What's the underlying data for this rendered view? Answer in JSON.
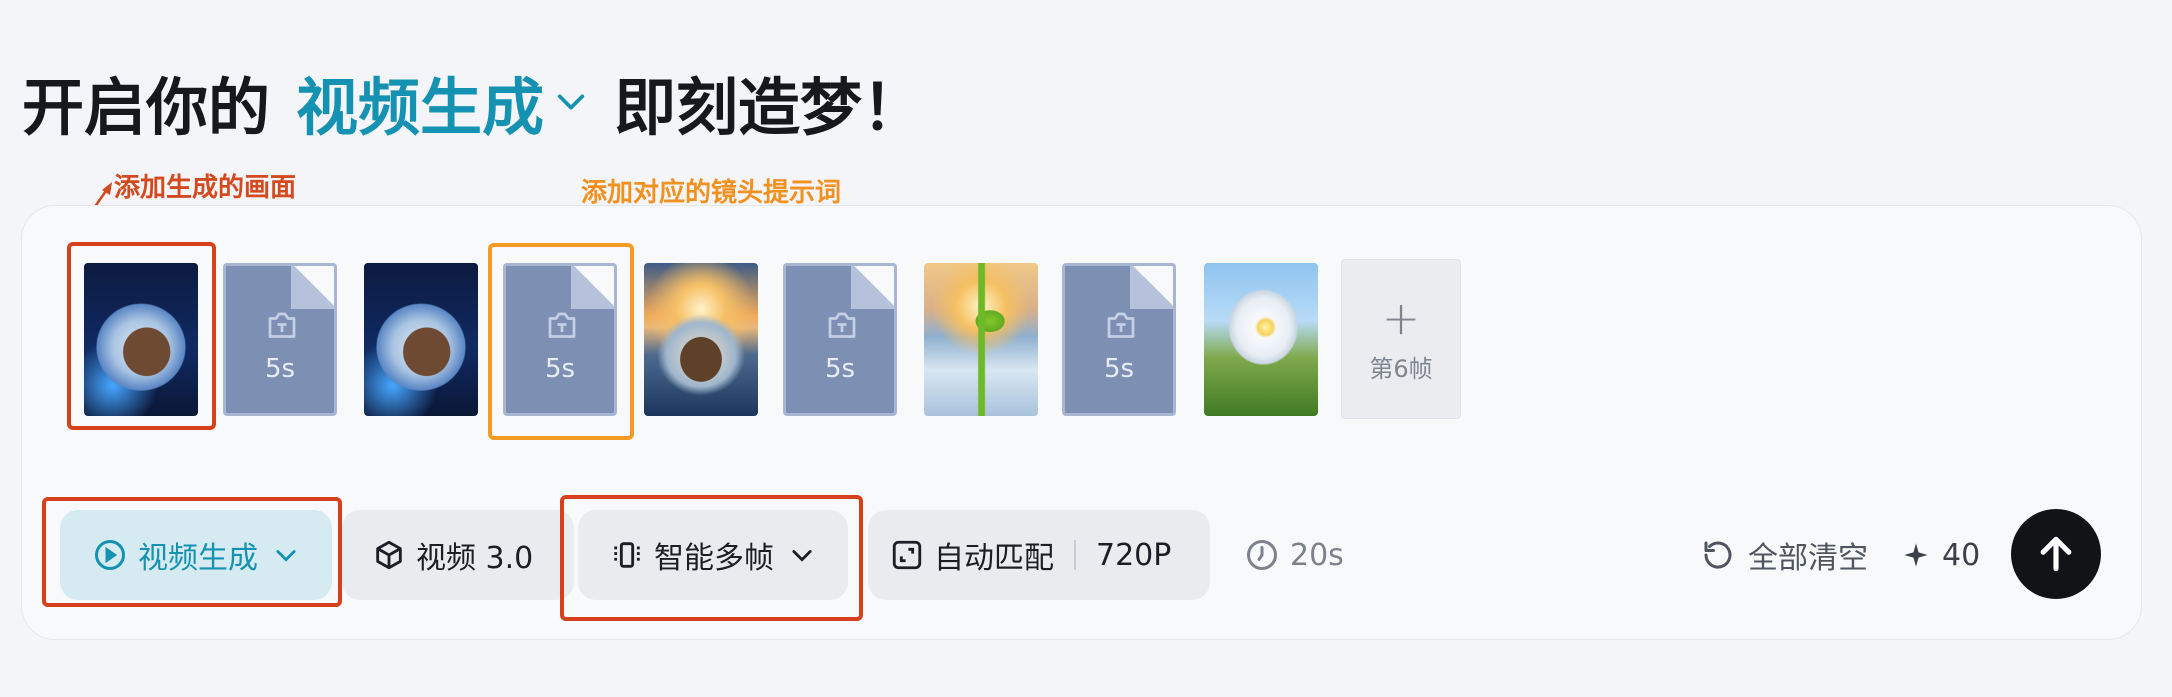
{
  "headline": {
    "prefix": "开启你的",
    "mode": "视频生成",
    "suffix": "即刻造梦！"
  },
  "annotations": {
    "add_frame_note": "添加生成的画面",
    "add_prompt_note": "添加对应的镜头提示词"
  },
  "timeline": {
    "frames": [
      {
        "kind": "image",
        "icon": "ice-crystal-image"
      },
      {
        "kind": "prompt",
        "duration": "5s"
      },
      {
        "kind": "image",
        "icon": "ice-crystal-image"
      },
      {
        "kind": "prompt",
        "duration": "5s"
      },
      {
        "kind": "image",
        "icon": "sunset-ice-image"
      },
      {
        "kind": "prompt",
        "duration": "5s"
      },
      {
        "kind": "image",
        "icon": "sprout-image"
      },
      {
        "kind": "prompt",
        "duration": "5s"
      },
      {
        "kind": "image",
        "icon": "flower-image"
      }
    ],
    "add_label": "第6帧"
  },
  "toolbar": {
    "mode_label": "视频生成",
    "model_label": "视频 3.0",
    "multi_frame_label": "智能多帧",
    "ratio_label": "自动匹配",
    "resolution_label": "720P",
    "duration_label": "20s",
    "clear_label": "全部清空",
    "credits": "40"
  },
  "colors": {
    "accent": "#1592b1",
    "highlight_red": "#d6401d",
    "highlight_orange": "#f59a22",
    "send_button": "#111317"
  }
}
